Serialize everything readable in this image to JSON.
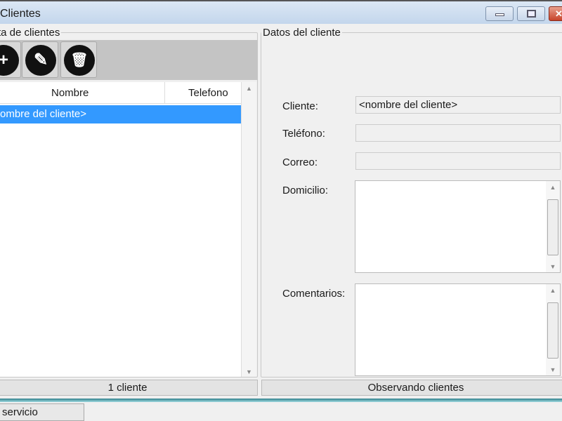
{
  "window": {
    "title": "Clientes"
  },
  "list_panel": {
    "legend": "ta de clientes",
    "columns": [
      "Nombre",
      "Telefono"
    ],
    "rows": [
      {
        "nombre": "ombre del cliente>",
        "telefono": ""
      }
    ],
    "status": "1 cliente"
  },
  "toolbar": {
    "icons": [
      "add-icon",
      "edit-icon",
      "delete-icon"
    ]
  },
  "detail_panel": {
    "legend": "Datos del cliente",
    "cliente_label": "Cliente:",
    "cliente_value": "<nombre del cliente>",
    "telefono_label": "Teléfono:",
    "telefono_value": "",
    "correo_label": "Correo:",
    "correo_value": "",
    "domicilio_label": "Domicilio:",
    "comentarios_label": "Comentarios:",
    "status": "Observando clientes"
  },
  "taskbar": {
    "item": "servicio"
  },
  "colors": {
    "selection": "#3399ff"
  }
}
